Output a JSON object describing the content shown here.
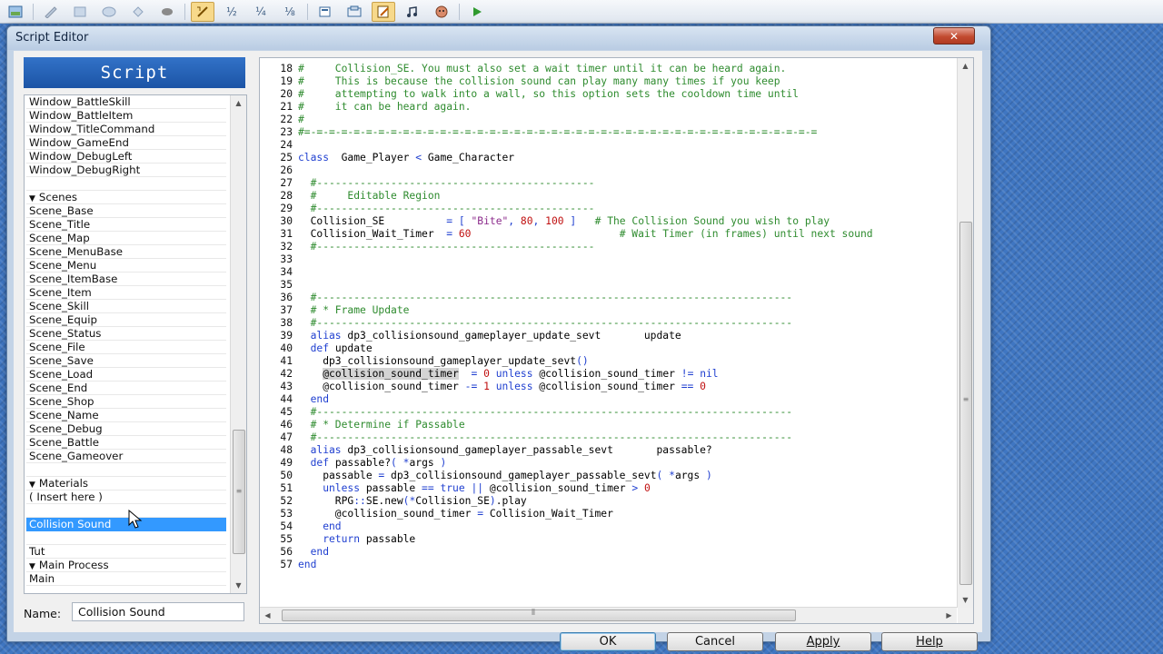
{
  "toolbar": {
    "buttons": [
      {
        "icon": "map-editor-icon"
      },
      {
        "icon": "pencil-icon"
      },
      {
        "icon": "rectangle-icon"
      },
      {
        "icon": "ellipse-icon"
      },
      {
        "icon": "flood-fill-icon"
      },
      {
        "icon": "shadow-pen-icon"
      },
      {
        "icon": "zoom-1-1-icon"
      },
      {
        "icon": "zoom-1-2-icon"
      },
      {
        "icon": "zoom-1-4-icon"
      },
      {
        "icon": "zoom-1-8-icon"
      },
      {
        "icon": "database-icon"
      },
      {
        "icon": "resource-manager-icon"
      },
      {
        "icon": "script-editor-icon"
      },
      {
        "icon": "sound-test-icon"
      },
      {
        "icon": "character-generator-icon"
      },
      {
        "icon": "playtest-icon"
      }
    ],
    "zoom_labels": {
      "z2": "½",
      "z4": "¼",
      "z8": "⅛"
    }
  },
  "dialog": {
    "title": "Script Editor",
    "close_label": "✕",
    "panel_header": "Script",
    "script_list": [
      {
        "label": "Window_BattleSkill"
      },
      {
        "label": "Window_BattleItem"
      },
      {
        "label": "Window_TitleCommand"
      },
      {
        "label": "Window_GameEnd"
      },
      {
        "label": "Window_DebugLeft"
      },
      {
        "label": "Window_DebugRight"
      },
      {
        "label": ""
      },
      {
        "label": "Scenes",
        "section": true
      },
      {
        "label": "Scene_Base"
      },
      {
        "label": "Scene_Title"
      },
      {
        "label": "Scene_Map"
      },
      {
        "label": "Scene_MenuBase"
      },
      {
        "label": "Scene_Menu"
      },
      {
        "label": "Scene_ItemBase"
      },
      {
        "label": "Scene_Item"
      },
      {
        "label": "Scene_Skill"
      },
      {
        "label": "Scene_Equip"
      },
      {
        "label": "Scene_Status"
      },
      {
        "label": "Scene_File"
      },
      {
        "label": "Scene_Save"
      },
      {
        "label": "Scene_Load"
      },
      {
        "label": "Scene_End"
      },
      {
        "label": "Scene_Shop"
      },
      {
        "label": "Scene_Name"
      },
      {
        "label": "Scene_Debug"
      },
      {
        "label": "Scene_Battle"
      },
      {
        "label": "Scene_Gameover"
      },
      {
        "label": ""
      },
      {
        "label": "Materials",
        "section": true
      },
      {
        "label": "( Insert here )"
      },
      {
        "label": ""
      },
      {
        "label": "Collision Sound",
        "selected": true
      },
      {
        "label": ""
      },
      {
        "label": "Tut"
      },
      {
        "label": "Main Process",
        "section": true
      },
      {
        "label": "Main"
      }
    ],
    "name_label": "Name:",
    "name_value": "Collision Sound",
    "code_lines": [
      {
        "n": "18",
        "segs": [
          [
            "c-com",
            "#     Collision_SE. You must also set a wait timer until it can be heard again."
          ]
        ]
      },
      {
        "n": "19",
        "segs": [
          [
            "c-com",
            "#     This is because the collision sound can play many many times if you keep"
          ]
        ]
      },
      {
        "n": "20",
        "segs": [
          [
            "c-com",
            "#     attempting to walk into a wall, so this option sets the cooldown time until"
          ]
        ]
      },
      {
        "n": "21",
        "segs": [
          [
            "c-com",
            "#     it can be heard again."
          ]
        ]
      },
      {
        "n": "22",
        "segs": [
          [
            "c-com",
            "#"
          ]
        ]
      },
      {
        "n": "23",
        "segs": [
          [
            "c-com",
            "#=-=-=-=-=-=-=-=-=-=-=-=-=-=-=-=-=-=-=-=-=-=-=-=-=-=-=-=-=-=-=-=-=-=-=-=-=-=-=-=-=-="
          ]
        ]
      },
      {
        "n": "24",
        "segs": []
      },
      {
        "n": "25",
        "segs": [
          [
            "c-kw",
            "class"
          ],
          [
            "",
            "  Game_Player "
          ],
          [
            "c-op",
            "<"
          ],
          [
            "",
            " Game_Character"
          ]
        ]
      },
      {
        "n": "26",
        "segs": []
      },
      {
        "n": "27",
        "segs": [
          [
            "c-com",
            "  #---------------------------------------------"
          ]
        ]
      },
      {
        "n": "28",
        "segs": [
          [
            "c-com",
            "  #     Editable Region"
          ]
        ]
      },
      {
        "n": "29",
        "segs": [
          [
            "c-com",
            "  #---------------------------------------------"
          ]
        ]
      },
      {
        "n": "30",
        "segs": [
          [
            "",
            "  Collision_SE          "
          ],
          [
            "c-op",
            "="
          ],
          [
            "",
            " "
          ],
          [
            "c-op",
            "["
          ],
          [
            "",
            " "
          ],
          [
            "c-str",
            "\"Bite\""
          ],
          [
            "c-op",
            ","
          ],
          [
            "",
            " "
          ],
          [
            "c-num",
            "80"
          ],
          [
            "c-op",
            ","
          ],
          [
            "",
            " "
          ],
          [
            "c-num",
            "100"
          ],
          [
            "",
            " "
          ],
          [
            "c-op",
            "]"
          ],
          [
            "",
            "   "
          ],
          [
            "c-com",
            "# The Collision Sound you wish to play"
          ]
        ]
      },
      {
        "n": "31",
        "segs": [
          [
            "",
            "  Collision_Wait_Timer  "
          ],
          [
            "c-op",
            "="
          ],
          [
            "",
            " "
          ],
          [
            "c-num",
            "60"
          ],
          [
            "",
            "                        "
          ],
          [
            "c-com",
            "# Wait Timer (in frames) until next sound"
          ]
        ]
      },
      {
        "n": "32",
        "segs": [
          [
            "c-com",
            "  #---------------------------------------------"
          ]
        ]
      },
      {
        "n": "33",
        "segs": []
      },
      {
        "n": "34",
        "segs": []
      },
      {
        "n": "35",
        "segs": []
      },
      {
        "n": "36",
        "segs": [
          [
            "c-com",
            "  #-----------------------------------------------------------------------------"
          ]
        ]
      },
      {
        "n": "37",
        "segs": [
          [
            "c-com",
            "  # * Frame Update"
          ]
        ]
      },
      {
        "n": "38",
        "segs": [
          [
            "c-com",
            "  #-----------------------------------------------------------------------------"
          ]
        ]
      },
      {
        "n": "39",
        "segs": [
          [
            "c-kw",
            "  alias"
          ],
          [
            "",
            " dp3_collisionsound_gameplayer_update_sevt       update"
          ]
        ]
      },
      {
        "n": "40",
        "segs": [
          [
            "c-kw",
            "  def"
          ],
          [
            "",
            " update"
          ]
        ]
      },
      {
        "n": "41",
        "segs": [
          [
            "",
            "    dp3_collisionsound_gameplayer_update_sevt"
          ],
          [
            "c-op",
            "()"
          ]
        ]
      },
      {
        "n": "42",
        "segs": [
          [
            "",
            "    "
          ],
          [
            "c-hl",
            "@collision_sound_timer"
          ],
          [
            "",
            "  "
          ],
          [
            "c-op",
            "="
          ],
          [
            "",
            " "
          ],
          [
            "c-num",
            "0"
          ],
          [
            "",
            " "
          ],
          [
            "c-kw",
            "unless"
          ],
          [
            "",
            " @collision_sound_timer "
          ],
          [
            "c-op",
            "!="
          ],
          [
            "",
            " "
          ],
          [
            "c-kw",
            "nil"
          ]
        ]
      },
      {
        "n": "43",
        "segs": [
          [
            "",
            "    @collision_sound_timer "
          ],
          [
            "c-op",
            "-="
          ],
          [
            "",
            " "
          ],
          [
            "c-num",
            "1"
          ],
          [
            "",
            " "
          ],
          [
            "c-kw",
            "unless"
          ],
          [
            "",
            " @collision_sound_timer "
          ],
          [
            "c-op",
            "=="
          ],
          [
            "",
            " "
          ],
          [
            "c-num",
            "0"
          ]
        ]
      },
      {
        "n": "44",
        "segs": [
          [
            "c-kw",
            "  end"
          ]
        ]
      },
      {
        "n": "45",
        "segs": [
          [
            "c-com",
            "  #-----------------------------------------------------------------------------"
          ]
        ]
      },
      {
        "n": "46",
        "segs": [
          [
            "c-com",
            "  # * Determine if Passable"
          ]
        ]
      },
      {
        "n": "47",
        "segs": [
          [
            "c-com",
            "  #-----------------------------------------------------------------------------"
          ]
        ]
      },
      {
        "n": "48",
        "segs": [
          [
            "c-kw",
            "  alias"
          ],
          [
            "",
            " dp3_collisionsound_gameplayer_passable_sevt       passable?"
          ]
        ]
      },
      {
        "n": "49",
        "segs": [
          [
            "c-kw",
            "  def"
          ],
          [
            "",
            " passable?"
          ],
          [
            "c-op",
            "("
          ],
          [
            "",
            " "
          ],
          [
            "c-op",
            "*"
          ],
          [
            "",
            "args "
          ],
          [
            "c-op",
            ")"
          ]
        ]
      },
      {
        "n": "50",
        "segs": [
          [
            "",
            "    passable "
          ],
          [
            "c-op",
            "="
          ],
          [
            "",
            " dp3_collisionsound_gameplayer_passable_sevt"
          ],
          [
            "c-op",
            "("
          ],
          [
            "",
            " "
          ],
          [
            "c-op",
            "*"
          ],
          [
            "",
            "args "
          ],
          [
            "c-op",
            ")"
          ]
        ]
      },
      {
        "n": "51",
        "segs": [
          [
            "c-kw",
            "    unless"
          ],
          [
            "",
            " passable "
          ],
          [
            "c-op",
            "=="
          ],
          [
            "",
            " "
          ],
          [
            "c-kw",
            "true"
          ],
          [
            "",
            " "
          ],
          [
            "c-op",
            "||"
          ],
          [
            "",
            " @collision_sound_timer "
          ],
          [
            "c-op",
            ">"
          ],
          [
            "",
            " "
          ],
          [
            "c-num",
            "0"
          ]
        ]
      },
      {
        "n": "52",
        "segs": [
          [
            "",
            "      RPG"
          ],
          [
            "c-op",
            "::"
          ],
          [
            "",
            "SE.new"
          ],
          [
            "c-op",
            "(*"
          ],
          [
            "",
            "Collision_SE"
          ],
          [
            "c-op",
            ")"
          ],
          [
            "",
            ".play"
          ]
        ]
      },
      {
        "n": "53",
        "segs": [
          [
            "",
            "      @collision_sound_timer "
          ],
          [
            "c-op",
            "="
          ],
          [
            "",
            " Collision_Wait_Timer"
          ]
        ]
      },
      {
        "n": "54",
        "segs": [
          [
            "c-kw",
            "    end"
          ]
        ]
      },
      {
        "n": "55",
        "segs": [
          [
            "c-kw",
            "    return"
          ],
          [
            "",
            " passable"
          ]
        ]
      },
      {
        "n": "56",
        "segs": [
          [
            "c-kw",
            "  end"
          ]
        ]
      },
      {
        "n": "57",
        "segs": [
          [
            "c-kw",
            "end"
          ]
        ]
      }
    ],
    "buttons": {
      "ok": "OK",
      "cancel": "Cancel",
      "apply": "Apply",
      "help": "Help"
    }
  },
  "colors": {
    "comment": "#2e8b2e",
    "keyword": "#1f3fd0",
    "string": "#8b2a8b",
    "number": "#c01010",
    "selection": "#3399ff",
    "header": "#1c54a6"
  }
}
